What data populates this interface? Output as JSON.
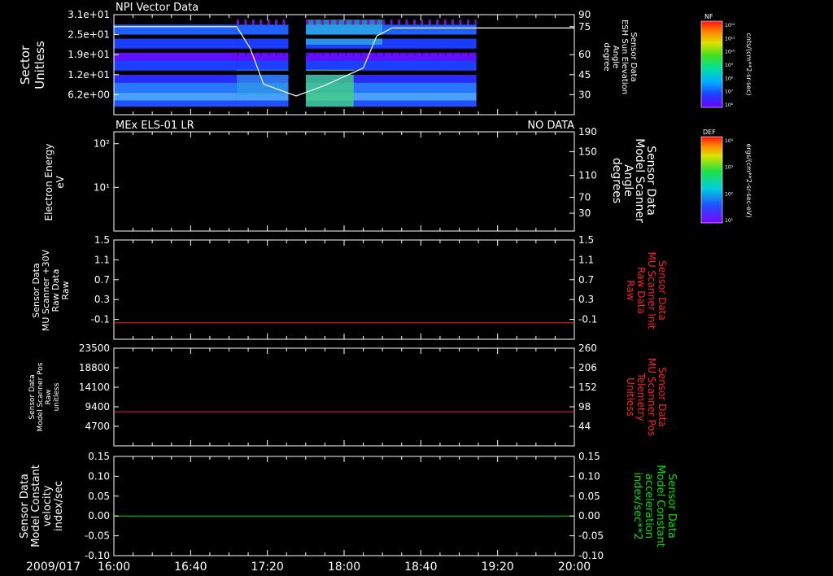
{
  "panel1": {
    "title": "NPI Vector Data",
    "left_label": [
      "Sector",
      "Unitless"
    ],
    "right_label": [
      "Sensor Data",
      "ESH Sun Elevation",
      "Angle",
      "degree"
    ],
    "left_ticks": [
      "3.1e+01",
      "2.5e+01",
      "1.9e+01",
      "1.2e+01",
      "6.2e+00"
    ],
    "right_ticks": [
      "90",
      "75",
      "60",
      "45",
      "30"
    ],
    "colorbar": {
      "title": "NF",
      "ticks": [
        "10¹²",
        "10¹¹",
        "10¹⁰",
        "10⁹",
        "10⁸",
        "10⁷",
        "10⁶"
      ],
      "unit": "cnts/(cm**2-sr-sec)"
    }
  },
  "panel2": {
    "title": "MEx ELS-01 LR",
    "status": "NO DATA",
    "left_label": [
      "Electron Energy",
      "eV"
    ],
    "right_label": [
      "Sensor Data",
      "Model Scanner",
      "Angle",
      "degrees"
    ],
    "left_ticks": [
      "10²",
      "10¹"
    ],
    "right_ticks": [
      "190",
      "150",
      "110",
      "70",
      "30"
    ],
    "colorbar": {
      "title": "DEF",
      "ticks": [
        "10⁴",
        "10³",
        "10²",
        "10¹"
      ],
      "unit": "ergs/(cm**2-sr-sec-eV)"
    }
  },
  "panel3": {
    "left_label": [
      "Sensor Data",
      "MU Scanner +30V",
      "Raw Data",
      "Raw"
    ],
    "right_label": [
      "Sensor Data",
      "MU Scanner Init",
      "Raw Data",
      "Raw"
    ],
    "left_ticks": [
      "1.5",
      "1.1",
      "0.7",
      "0.3",
      "-0.1"
    ],
    "right_ticks": [
      "1.5",
      "1.1",
      "0.7",
      "0.3",
      "-0.1"
    ]
  },
  "panel4": {
    "left_label": [
      "Sensor Data",
      "Model Scanner Pos",
      "Raw",
      "unitless"
    ],
    "right_label": [
      "Sensor Data",
      "MU Scanner Pos",
      "Telemetry",
      "Unitless"
    ],
    "left_ticks": [
      "23500",
      "18800",
      "14100",
      "9400",
      "4700"
    ],
    "right_ticks": [
      "260",
      "206",
      "152",
      "98",
      "44"
    ]
  },
  "panel5": {
    "left_label": [
      "Sensor Data",
      "Model Constant",
      "velocity",
      "index/sec"
    ],
    "right_label": [
      "Sensor Data",
      "Model Constant",
      "acceleration",
      "index/sec**2"
    ],
    "left_ticks": [
      "0.15",
      "0.10",
      "0.05",
      "0.00",
      "-0.05",
      "-0.10"
    ],
    "right_ticks": [
      "0.15",
      "0.10",
      "0.05",
      "0.00",
      "-0.05",
      "-0.10"
    ]
  },
  "time_axis": {
    "date": "2009/017",
    "labels": [
      "16:00",
      "16:40",
      "17:20",
      "18:00",
      "18:40",
      "19:20",
      "20:00"
    ]
  },
  "colors": {
    "background": "#000000",
    "axis": "#ffffff",
    "red_trace": "#ff2020",
    "green_trace": "#00e000",
    "red_label": "#ff2020",
    "green_label": "#00e000"
  },
  "chart_data": [
    {
      "type": "heatmap",
      "title": "NPI Vector Data",
      "xlabel": "",
      "ylabel": "Sector Unitless",
      "x_range": [
        "16:00",
        "20:00"
      ],
      "ylim": [
        0,
        31
      ],
      "data_gaps": [
        [
          "17:31",
          "17:40"
        ],
        [
          "19:09",
          "20:00"
        ]
      ],
      "overlay_line": {
        "name": "ESH Sun Elevation Angle",
        "ylim": [
          15,
          90
        ],
        "x": [
          "16:00",
          "17:04",
          "17:11",
          "17:18",
          "17:35",
          "17:50",
          "18:10",
          "18:17",
          "18:25",
          "19:10",
          "19:40",
          "20:00"
        ],
        "y": [
          81,
          81,
          65,
          38,
          29,
          37,
          50,
          74,
          80,
          80,
          80,
          80
        ]
      }
    },
    {
      "type": "line",
      "title": "MEx ELS-01 LR",
      "note": "NO DATA",
      "ylabel": "Electron Energy eV",
      "series": [
        {
          "name": "Model Scanner Angle",
          "x": [
            "16:00",
            "20:00"
          ],
          "y": [
            10,
            10
          ]
        }
      ],
      "ylim": [
        10,
        190
      ]
    },
    {
      "type": "line",
      "ylabel": "MU Scanner +30V Raw",
      "series": [
        {
          "name": "MU Scanner Init Raw",
          "x": [
            "16:00",
            "20:00"
          ],
          "y": [
            0.0,
            0.0
          ]
        }
      ],
      "ylim": [
        -0.3,
        1.5
      ]
    },
    {
      "type": "line",
      "ylabel": "Model Scanner Pos Raw unitless",
      "series": [
        {
          "name": "MU Scanner Pos Telemetry",
          "x": [
            "16:00",
            "20:00"
          ],
          "y": [
            8200,
            8200
          ]
        }
      ],
      "ylim": [
        0,
        23500
      ]
    },
    {
      "type": "line",
      "ylabel": "Model Constant velocity index/sec",
      "series": [
        {
          "name": "Model Constant acceleration",
          "x": [
            "16:00",
            "20:00"
          ],
          "y": [
            0.0,
            0.0
          ]
        }
      ],
      "ylim": [
        -0.1,
        0.15
      ]
    }
  ]
}
